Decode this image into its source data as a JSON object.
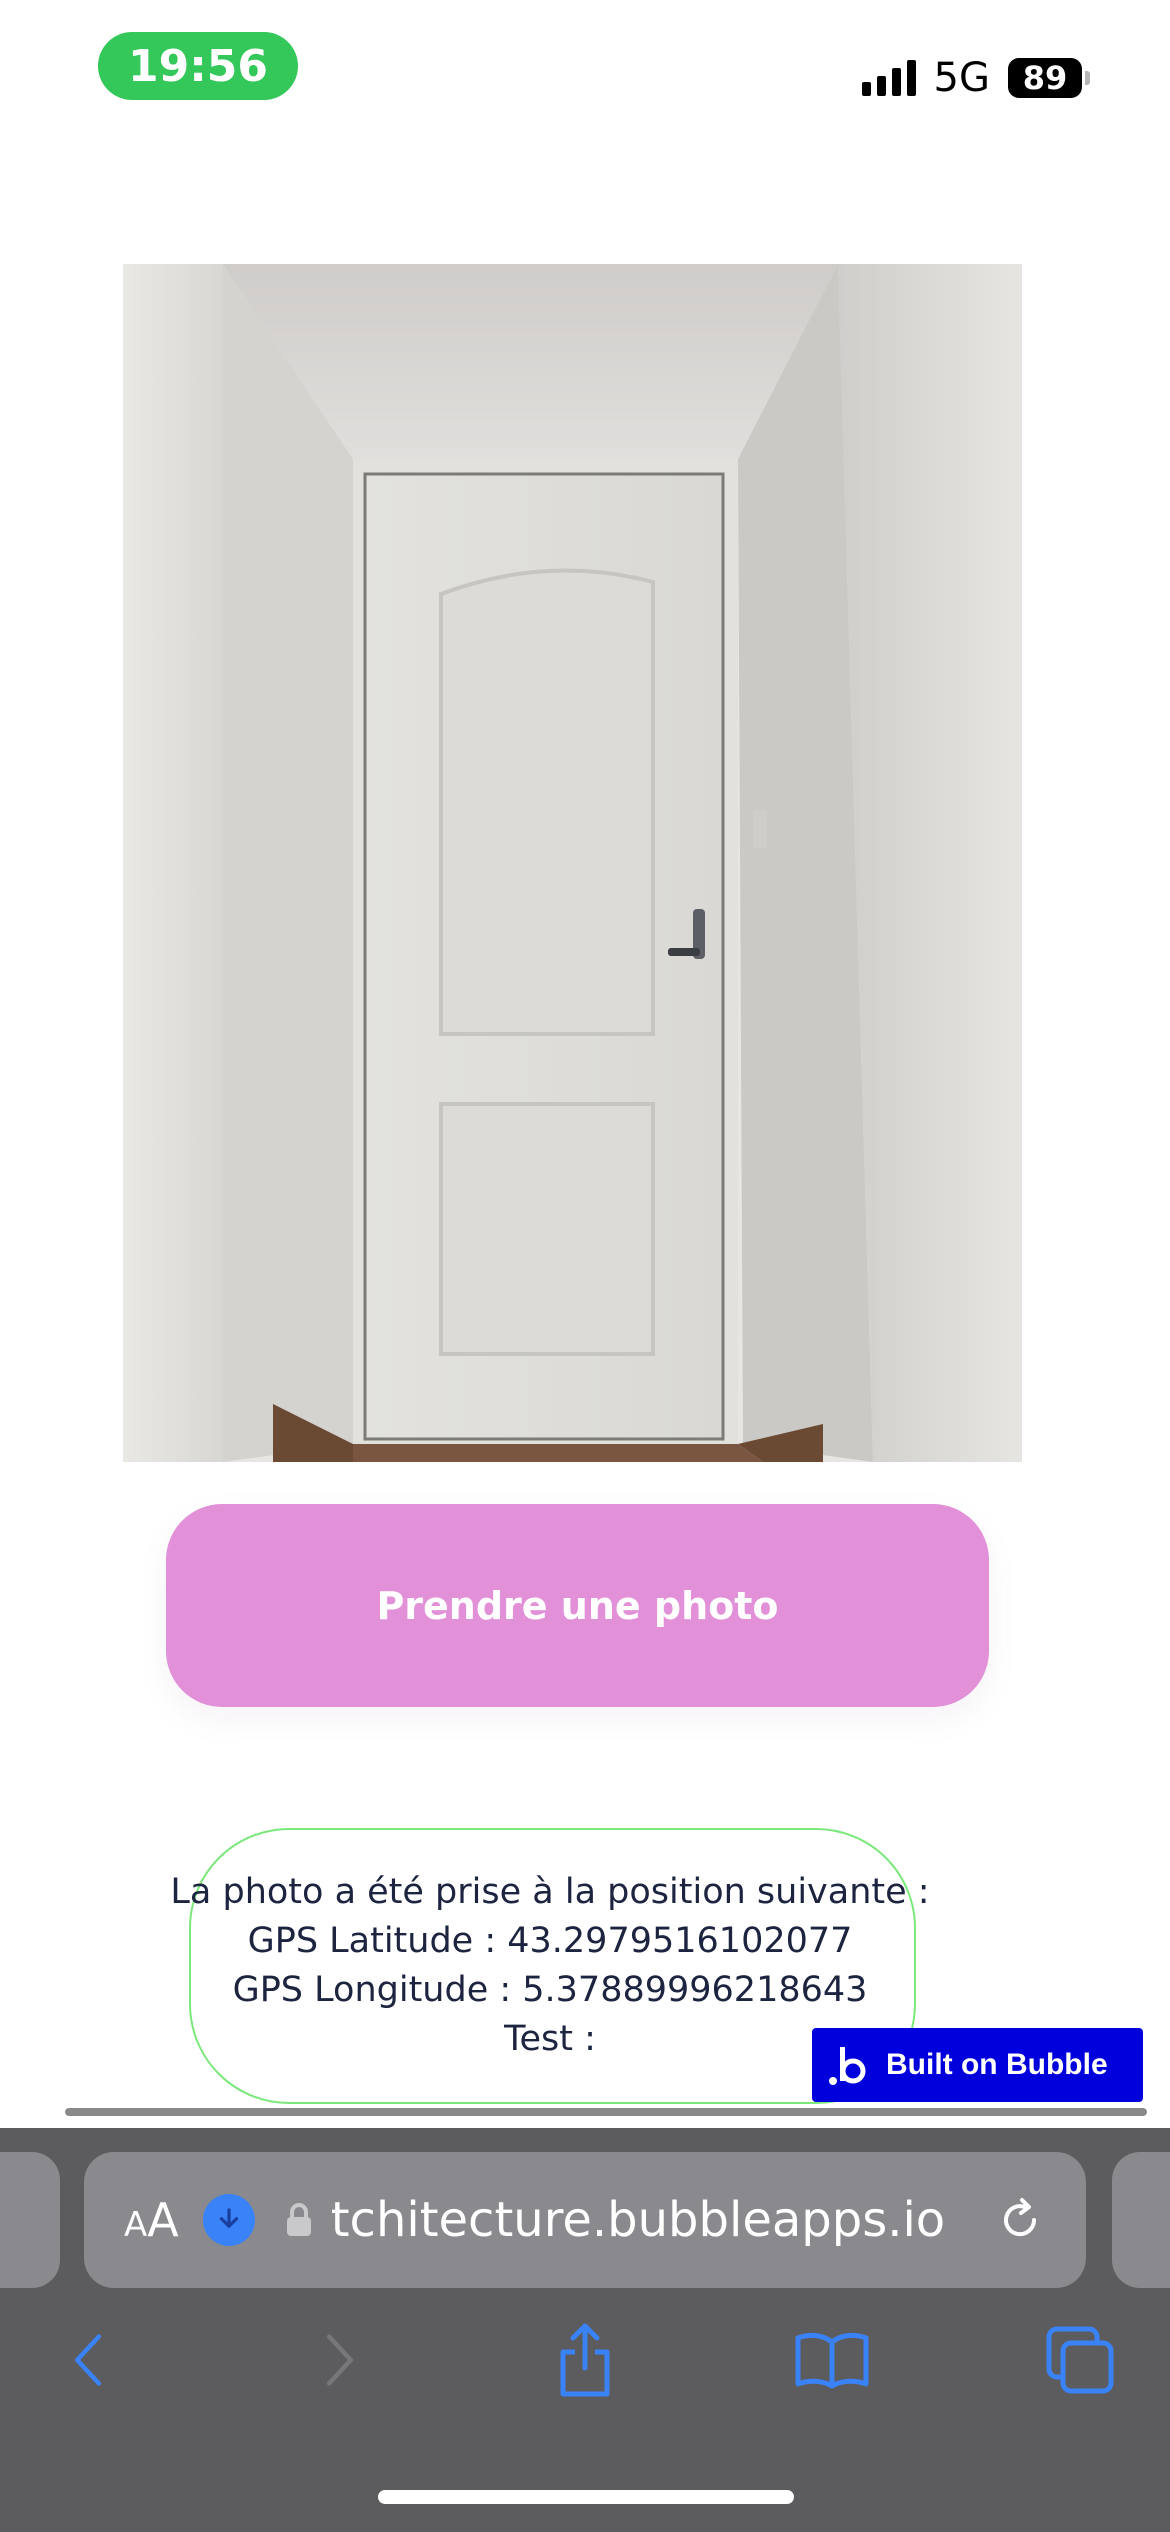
{
  "status_bar": {
    "time": "19:56",
    "network": "5G",
    "battery": "89",
    "time_color": "#34c759"
  },
  "photo": {
    "subject": "door-photo"
  },
  "main": {
    "take_photo_label": "Prendre une photo",
    "button_color": "#e290d8",
    "location": {
      "line1": "La photo a été prise à la position suivante :",
      "line2": "GPS Latitude : 43.2979516102077",
      "line3": "GPS Longitude : 5.37889996218643",
      "line4": "Test :"
    }
  },
  "badge": {
    "label": "Built on Bubble",
    "color": "#0000dd"
  },
  "browser": {
    "text_size_label": "AA",
    "url": "tchitecture.bubbleapps.io",
    "icons": [
      "download-icon",
      "lock-icon",
      "reload-icon",
      "back-icon",
      "forward-icon",
      "share-icon",
      "bookmarks-icon",
      "tabs-icon"
    ]
  }
}
